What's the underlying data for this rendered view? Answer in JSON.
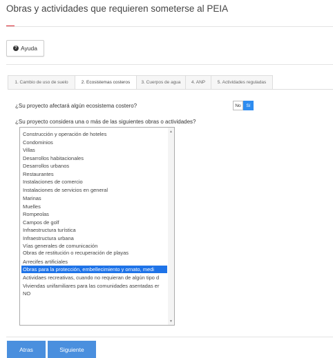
{
  "page": {
    "title": "Obras y actividades que requieren someterse al PEIA"
  },
  "help_button": {
    "label": "Ayuda",
    "icon": "question-circle-icon"
  },
  "tabs": [
    {
      "label": "1. Cambio de uso de suelo",
      "active": false
    },
    {
      "label": "2. Ecosistemas costeros",
      "active": true
    },
    {
      "label": "3. Cuerpos de agua",
      "active": false
    },
    {
      "label": "4. ANP",
      "active": false
    },
    {
      "label": "5. Actividades reguladas",
      "active": false
    }
  ],
  "questions": {
    "q1": "¿Su proyecto afectará algún ecosistema costero?",
    "q2": "¿Su proyecto considera una o más de las siguientes obras o actividades?"
  },
  "toggle": {
    "no_label": "No",
    "si_label": "Sí",
    "selected": "Sí",
    "selected_color": "#2d8cf0"
  },
  "options_list": {
    "items": [
      "Construcción y operación de hoteles",
      "Condominios",
      "Villas",
      "Desarrollos habitacionales",
      "Desarrollos urbanos",
      "Restaurantes",
      "Instalaciones de comercio",
      "Instalaciones de servicios en general",
      "Marinas",
      "Muelles",
      "Rompeolas",
      "Campos de golf",
      "Infraestructura turística",
      "Infraestructura urbana",
      "Vías generales de comunicación",
      "Obras de restitución o recuperación de playas",
      "Arrecifes artificiales",
      "Obras para la protección, embellecimiento y ornato, medi",
      "Actividaes recreativas, cuando no requieran de algún tipo d",
      "Viviendas unifamiliares para las comunidades asentadas er",
      "NO"
    ],
    "selected_index": 17
  },
  "footer": {
    "back_label": "Atras",
    "next_label": "Siguiente"
  },
  "colors": {
    "accent_red": "#d9232d",
    "primary_blue": "#4a8fde",
    "selected_blue": "#1e73e8"
  }
}
